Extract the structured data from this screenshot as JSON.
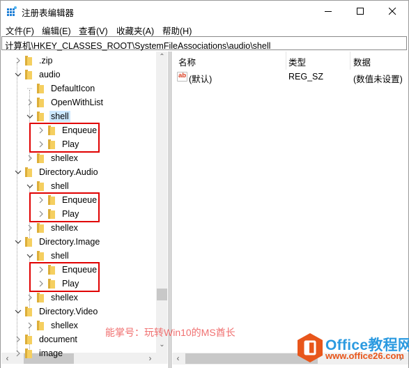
{
  "window": {
    "title": "注册表编辑器",
    "controls": {
      "minimize": "minimize-icon",
      "maximize": "maximize-icon",
      "close": "close-icon"
    }
  },
  "menu": [
    "文件(F)",
    "编辑(E)",
    "查看(V)",
    "收藏夹(A)",
    "帮助(H)"
  ],
  "address": "计算机\\HKEY_CLASSES_ROOT\\SystemFileAssociations\\audio\\shell",
  "tree": [
    {
      "label": ".zip",
      "level": 0,
      "expander": "collapsed"
    },
    {
      "label": "audio",
      "level": 0,
      "expander": "expanded"
    },
    {
      "label": "DefaultIcon",
      "level": 1,
      "expander": "none"
    },
    {
      "label": "OpenWithList",
      "level": 1,
      "expander": "collapsed"
    },
    {
      "label": "shell",
      "level": 1,
      "expander": "expanded",
      "selected": true
    },
    {
      "label": "Enqueue",
      "level": 2,
      "expander": "collapsed",
      "highlighted": true
    },
    {
      "label": "Play",
      "level": 2,
      "expander": "collapsed",
      "highlighted": true
    },
    {
      "label": "shellex",
      "level": 1,
      "expander": "collapsed"
    },
    {
      "label": "Directory.Audio",
      "level": 0,
      "expander": "expanded"
    },
    {
      "label": "shell",
      "level": 1,
      "expander": "expanded"
    },
    {
      "label": "Enqueue",
      "level": 2,
      "expander": "collapsed",
      "highlighted": true
    },
    {
      "label": "Play",
      "level": 2,
      "expander": "collapsed",
      "highlighted": true
    },
    {
      "label": "shellex",
      "level": 1,
      "expander": "collapsed"
    },
    {
      "label": "Directory.Image",
      "level": 0,
      "expander": "expanded"
    },
    {
      "label": "shell",
      "level": 1,
      "expander": "expanded"
    },
    {
      "label": "Enqueue",
      "level": 2,
      "expander": "collapsed",
      "highlighted": true
    },
    {
      "label": "Play",
      "level": 2,
      "expander": "collapsed",
      "highlighted": true
    },
    {
      "label": "shellex",
      "level": 1,
      "expander": "collapsed"
    },
    {
      "label": "Directory.Video",
      "level": 0,
      "expander": "expanded"
    },
    {
      "label": "shellex",
      "level": 1,
      "expander": "collapsed"
    },
    {
      "label": "document",
      "level": 0,
      "expander": "collapsed"
    },
    {
      "label": "image",
      "level": 0,
      "expander": "collapsed"
    }
  ],
  "list": {
    "columns": [
      "名称",
      "类型",
      "数据"
    ],
    "rows": [
      {
        "icon": "ab-string-icon",
        "icon_text": "ab",
        "name": "(默认)",
        "type": "REG_SZ",
        "data": "(数值未设置)"
      }
    ]
  },
  "watermark": "能掌号：玩转Win10的MS酋长",
  "logo": {
    "title": "Office教程网",
    "url": "www.office26.com"
  },
  "colors": {
    "highlight_box": "#e00000",
    "selection": "#cce8ff",
    "folder": "#f2c955",
    "watermark": "#f07070",
    "logo_blue": "#2b9ae0",
    "logo_orange": "#e8561b"
  }
}
